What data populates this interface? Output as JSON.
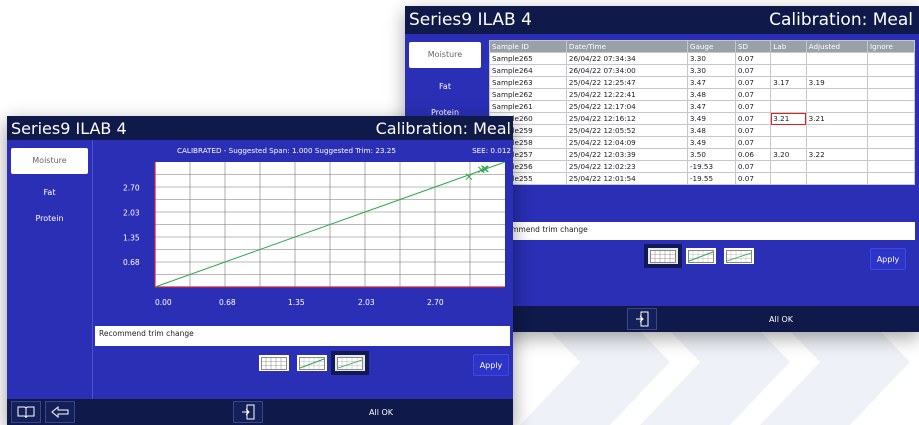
{
  "back_window": {
    "title_left": "Series9 ILAB 4",
    "title_right": "Calibration: Meal",
    "sidebar": [
      {
        "label": "Moisture",
        "active": true
      },
      {
        "label": "Fat",
        "active": false
      },
      {
        "label": "Protein",
        "active": false
      }
    ],
    "table": {
      "headers": [
        "Sample ID",
        "Date/Time",
        "Gauge",
        "SD",
        "Lab",
        "Adjusted",
        "Ignore"
      ],
      "rows": [
        [
          "Sample265",
          "26/04/22 07:34:34",
          "3.30",
          "0.07",
          "",
          "",
          ""
        ],
        [
          "Sample264",
          "26/04/22 07:34:00",
          "3.30",
          "0.07",
          "",
          "",
          ""
        ],
        [
          "Sample263",
          "25/04/22 12:25:47",
          "3.47",
          "0.07",
          "3.17",
          "3.19",
          ""
        ],
        [
          "Sample262",
          "25/04/22 12:22:41",
          "3.48",
          "0.07",
          "",
          "",
          ""
        ],
        [
          "Sample261",
          "25/04/22 12:17:04",
          "3.47",
          "0.07",
          "",
          "",
          ""
        ],
        [
          "Sample260",
          "25/04/22 12:16:12",
          "3.49",
          "0.07",
          "3.21",
          "3.21",
          ""
        ],
        [
          "Sample259",
          "25/04/22 12:05:52",
          "3.48",
          "0.07",
          "",
          "",
          ""
        ],
        [
          "Sample258",
          "25/04/22 12:04:09",
          "3.49",
          "0.07",
          "",
          "",
          ""
        ],
        [
          "Sample257",
          "25/04/22 12:03:39",
          "3.50",
          "0.06",
          "3.20",
          "3.22",
          ""
        ],
        [
          "Sample256",
          "25/04/22 12:02:23",
          "-19.53",
          "0.07",
          "",
          "",
          ""
        ],
        [
          "Sample255",
          "25/04/22 12:01:54",
          "-19.55",
          "0.07",
          "",
          "",
          ""
        ]
      ],
      "selected_row": 5,
      "selected_col": 4
    },
    "message": "Recommend trim change",
    "apply_label": "Apply",
    "status": "All OK",
    "active_view": 0
  },
  "front_window": {
    "title_left": "Series9 ILAB 4",
    "title_right": "Calibration: Meal",
    "sidebar": [
      {
        "label": "Moisture",
        "active": true
      },
      {
        "label": "Fat",
        "active": false
      },
      {
        "label": "Protein",
        "active": false
      }
    ],
    "chart_header": "CALIBRATED - Suggested Span: 1.000   Suggested Trim: 23.25",
    "see_label": "SEE: 0.012",
    "message": "Recommend trim change",
    "apply_label": "Apply",
    "status": "All OK",
    "active_view": 2
  },
  "chart_data": {
    "type": "scatter",
    "x_ticks": [
      "0.00",
      "0.68",
      "1.35",
      "2.03",
      "2.70"
    ],
    "y_ticks": [
      "2.70",
      "2.03",
      "1.35",
      "0.68"
    ],
    "xlim": [
      0,
      3.4
    ],
    "ylim": [
      0,
      3.4
    ],
    "line": {
      "x": [
        0,
        3.4
      ],
      "y": [
        0,
        3.4
      ]
    },
    "points": [
      {
        "x": 3.17,
        "y": 3.19
      },
      {
        "x": 3.2,
        "y": 3.22
      },
      {
        "x": 3.21,
        "y": 3.21
      },
      {
        "x": 3.05,
        "y": 3.0
      }
    ],
    "grid": true,
    "colors": {
      "line": "#2da84a",
      "points": "#2da84a",
      "axis_border": "#d0203a",
      "grid": "#777777"
    }
  }
}
